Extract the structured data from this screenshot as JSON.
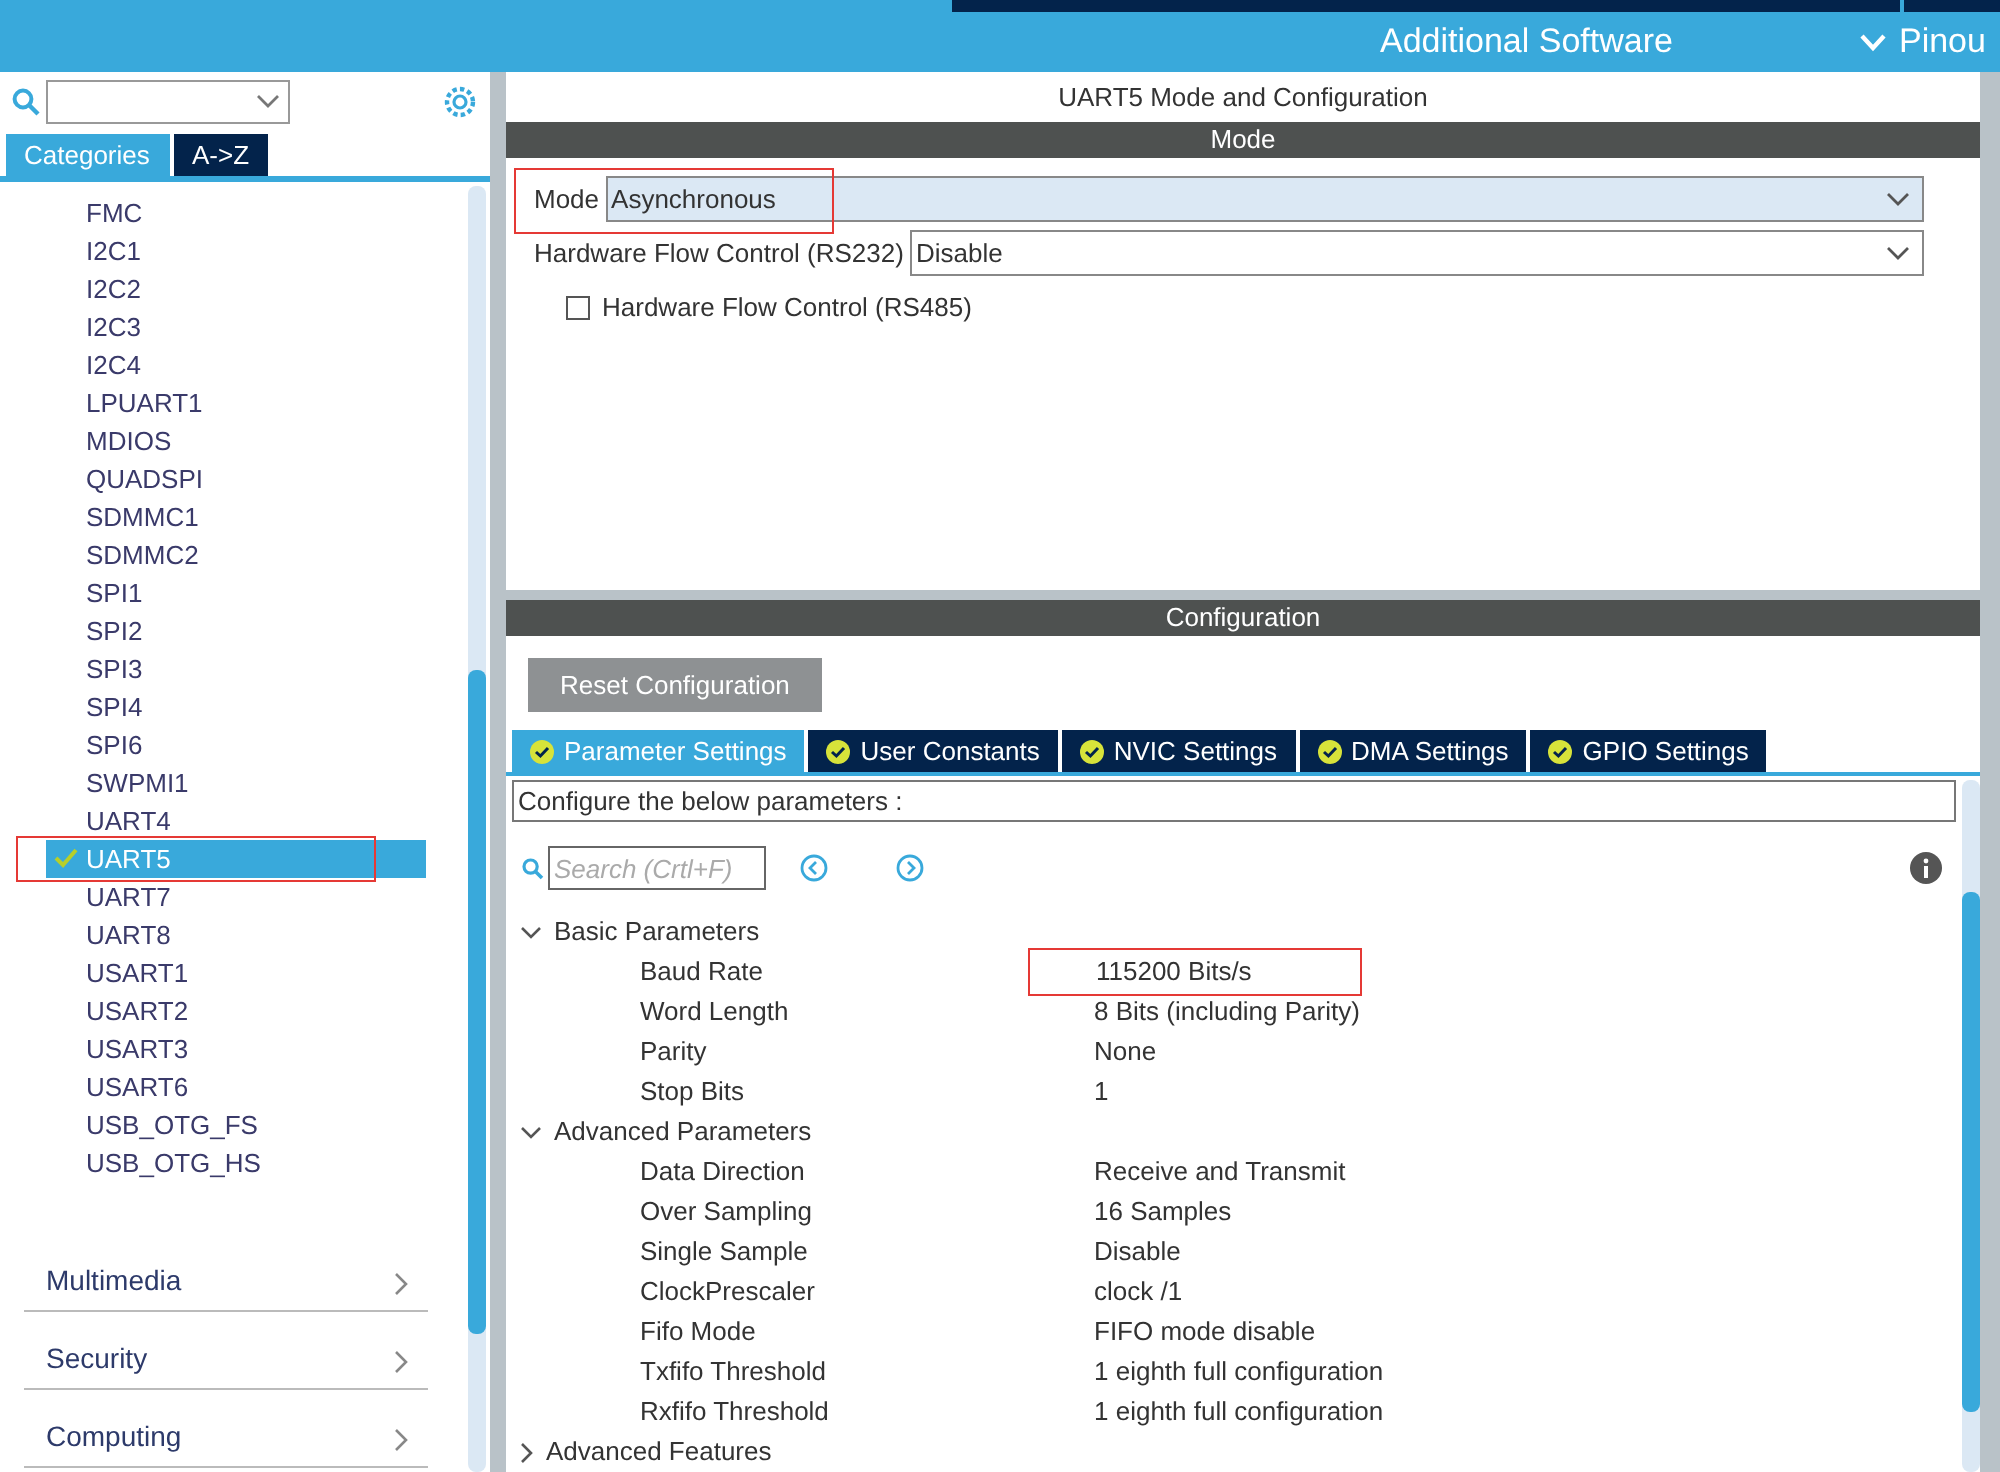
{
  "top_bar": {
    "tabs": [
      {
        "label": "Additional Software",
        "selected": false
      },
      {
        "label": "Pinou",
        "selected": false
      }
    ]
  },
  "sidebar": {
    "tabs": [
      {
        "label": "Categories",
        "selected": true
      },
      {
        "label": "A->Z",
        "selected": false
      }
    ],
    "items": [
      {
        "label": "FMC",
        "selected": false,
        "checked": false
      },
      {
        "label": "I2C1",
        "selected": false,
        "checked": false
      },
      {
        "label": "I2C2",
        "selected": false,
        "checked": false
      },
      {
        "label": "I2C3",
        "selected": false,
        "checked": false
      },
      {
        "label": "I2C4",
        "selected": false,
        "checked": false
      },
      {
        "label": "LPUART1",
        "selected": false,
        "checked": false
      },
      {
        "label": "MDIOS",
        "selected": false,
        "checked": false
      },
      {
        "label": "QUADSPI",
        "selected": false,
        "checked": false
      },
      {
        "label": "SDMMC1",
        "selected": false,
        "checked": false
      },
      {
        "label": "SDMMC2",
        "selected": false,
        "checked": false
      },
      {
        "label": "SPI1",
        "selected": false,
        "checked": false
      },
      {
        "label": "SPI2",
        "selected": false,
        "checked": false
      },
      {
        "label": "SPI3",
        "selected": false,
        "checked": false
      },
      {
        "label": "SPI4",
        "selected": false,
        "checked": false
      },
      {
        "label": "SPI6",
        "selected": false,
        "checked": false
      },
      {
        "label": "SWPMI1",
        "selected": false,
        "checked": false
      },
      {
        "label": "UART4",
        "selected": false,
        "checked": false
      },
      {
        "label": "UART5",
        "selected": true,
        "checked": true,
        "highlighted": true
      },
      {
        "label": "UART7",
        "selected": false,
        "checked": false
      },
      {
        "label": "UART8",
        "selected": false,
        "checked": false
      },
      {
        "label": "USART1",
        "selected": false,
        "checked": false
      },
      {
        "label": "USART2",
        "selected": false,
        "checked": false
      },
      {
        "label": "USART3",
        "selected": false,
        "checked": false
      },
      {
        "label": "USART6",
        "selected": false,
        "checked": false
      },
      {
        "label": "USB_OTG_FS",
        "selected": false,
        "checked": false
      },
      {
        "label": "USB_OTG_HS",
        "selected": false,
        "checked": false
      }
    ],
    "categories": [
      {
        "label": "Multimedia",
        "expanded": false
      },
      {
        "label": "Security",
        "expanded": false
      },
      {
        "label": "Computing",
        "expanded": false
      }
    ]
  },
  "panel": {
    "title": "UART5 Mode and Configuration",
    "mode_header": "Mode",
    "mode_fields": [
      {
        "label": "Mode",
        "value": "Asynchronous",
        "focused": true,
        "highlighted": true
      },
      {
        "label": "Hardware Flow Control (RS232)",
        "value": "Disable",
        "focused": false
      }
    ],
    "checkbox": {
      "label": "Hardware Flow Control (RS485)",
      "checked": false
    },
    "config_header": "Configuration",
    "reset_button": "Reset Configuration",
    "tabs": [
      {
        "label": "Parameter Settings",
        "selected": true
      },
      {
        "label": "User Constants",
        "selected": false
      },
      {
        "label": "NVIC Settings",
        "selected": false
      },
      {
        "label": "DMA Settings",
        "selected": false
      },
      {
        "label": "GPIO Settings",
        "selected": false
      }
    ],
    "description": "Configure the below parameters :",
    "search": {
      "placeholder": "Search (Crtl+F)"
    },
    "tree": [
      {
        "label": "Basic Parameters",
        "expanded": true,
        "children": [
          {
            "label": "Baud Rate",
            "value": "115200 Bits/s",
            "highlighted": true
          },
          {
            "label": "Word Length",
            "value": "8 Bits (including Parity)"
          },
          {
            "label": "Parity",
            "value": "None"
          },
          {
            "label": "Stop Bits",
            "value": "1"
          }
        ]
      },
      {
        "label": "Advanced Parameters",
        "expanded": true,
        "children": [
          {
            "label": "Data Direction",
            "value": "Receive and Transmit"
          },
          {
            "label": "Over Sampling",
            "value": "16 Samples"
          },
          {
            "label": "Single Sample",
            "value": "Disable"
          },
          {
            "label": "ClockPrescaler",
            "value": "clock /1"
          },
          {
            "label": "Fifo Mode",
            "value": "FIFO mode disable"
          },
          {
            "label": "Txfifo Threshold",
            "value": "1 eighth full configuration"
          },
          {
            "label": "Rxfifo Threshold",
            "value": "1 eighth full configuration"
          }
        ]
      },
      {
        "label": "Advanced Features",
        "expanded": false
      }
    ]
  }
}
